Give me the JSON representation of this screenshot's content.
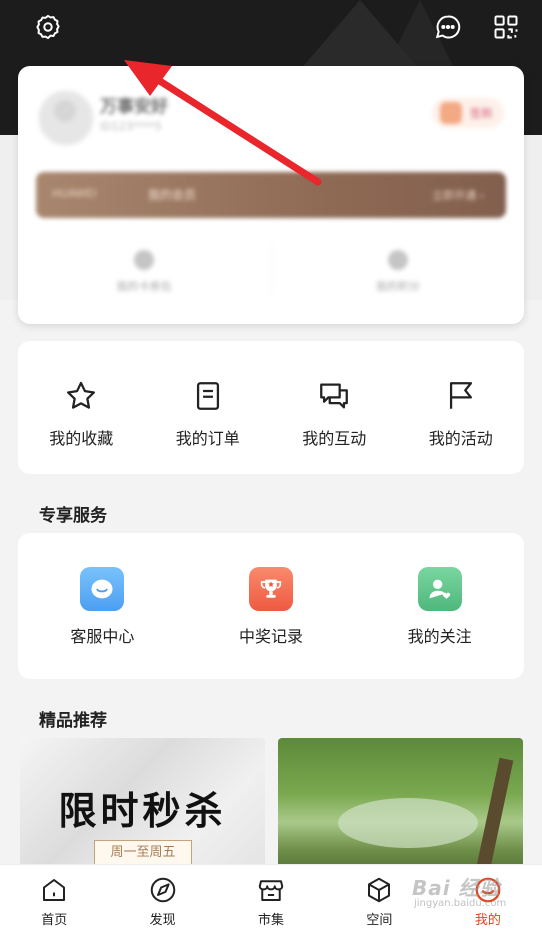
{
  "header": {
    "settings_icon": "gear-icon",
    "message_icon": "chat-bubble-icon",
    "scan_icon": "grid-scan-icon"
  },
  "profile": {
    "username": "万事安好",
    "subtitle": "ID123****5",
    "checkin_label": "签到",
    "vip_brand": "HUAWEI",
    "vip_label": "我的会员",
    "vip_action": "立即开通 ›",
    "stats": [
      {
        "label": "我的卡券包"
      },
      {
        "label": "我的积分"
      }
    ]
  },
  "quick_actions": [
    {
      "icon": "star-icon",
      "label": "我的收藏"
    },
    {
      "icon": "order-icon",
      "label": "我的订单"
    },
    {
      "icon": "interaction-icon",
      "label": "我的互动"
    },
    {
      "icon": "flag-icon",
      "label": "我的活动"
    }
  ],
  "services": {
    "title": "专享服务",
    "items": [
      {
        "icon": "customer-service-icon",
        "label": "客服中心",
        "color": "#5aaef5"
      },
      {
        "icon": "trophy-icon",
        "label": "中奖记录",
        "color": "#f26a4e"
      },
      {
        "icon": "follow-user-icon",
        "label": "我的关注",
        "color": "#5cc28a"
      }
    ]
  },
  "recommendations": {
    "title": "精品推荐",
    "left_title": "限时秒杀",
    "left_subtitle": "周一至周五"
  },
  "tabbar": [
    {
      "icon": "home-icon",
      "label": "首页"
    },
    {
      "icon": "compass-icon",
      "label": "发现"
    },
    {
      "icon": "store-icon",
      "label": "市集"
    },
    {
      "icon": "cube-icon",
      "label": "空间"
    },
    {
      "icon": "me-icon",
      "label": "我的",
      "active": true
    }
  ],
  "watermark": {
    "text": "Bai 经验",
    "sub": "jingyan.baidu.com"
  },
  "accent_color": "#e0461f",
  "annotation_color": "#e8262b"
}
